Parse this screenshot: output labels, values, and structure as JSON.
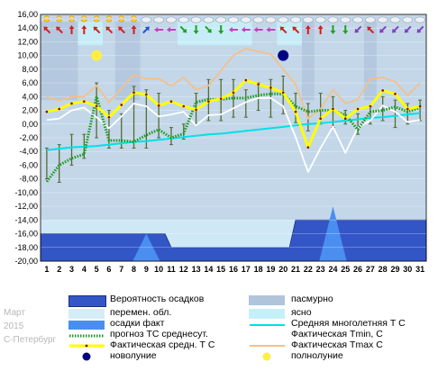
{
  "meta": {
    "month": "Март",
    "year": "2015",
    "city": "С-Петербург"
  },
  "colors": {
    "plot_bg": "#c3d7e9",
    "overcast_band": "#b0c4dc",
    "clear_band": "#c6f0f8",
    "precip_prob": "#3356c6",
    "precip_fact": "#4a8ef0",
    "normal_line": "#00e0e8",
    "fact_avg": "#ffff00",
    "fact_avg_outline": "#c8a800",
    "tmin": "#ffffff",
    "tmax": "#f4c08a",
    "forecast": "#1a9a1a",
    "range_bars": "#556b2f"
  },
  "chart_data": {
    "type": "line",
    "title": "",
    "xlabel": "",
    "ylabel": "",
    "x": [
      1,
      2,
      3,
      4,
      5,
      6,
      7,
      8,
      9,
      10,
      11,
      12,
      13,
      14,
      15,
      16,
      17,
      18,
      19,
      20,
      21,
      22,
      23,
      24,
      25,
      26,
      27,
      28,
      29,
      30,
      31
    ],
    "ylim": [
      -20,
      16
    ],
    "yticks": [
      "16,00",
      "14,00",
      "12,00",
      "10,00",
      "8,00",
      "6,00",
      "4,00",
      "2,00",
      "0,00",
      "-2,00",
      "-4,00",
      "-6,00",
      "-8,00",
      "-10,00",
      "-12,00",
      "-14,00",
      "-16,00",
      "-18,00",
      "-20,00"
    ],
    "xticks": [
      "1",
      "2",
      "3",
      "4",
      "5",
      "6",
      "7",
      "8",
      "9",
      "10",
      "11",
      "12",
      "13",
      "14",
      "15",
      "16",
      "17",
      "18",
      "19",
      "20",
      "21",
      "22",
      "23",
      "24",
      "25",
      "26",
      "27",
      "28",
      "29",
      "30",
      "31"
    ],
    "series": [
      {
        "name": "Фактическая средн. T C",
        "values": [
          1.8,
          2.2,
          3.0,
          3.3,
          2.6,
          1.0,
          2.8,
          4.6,
          4.3,
          2.7,
          3.3,
          2.6,
          2.1,
          3.3,
          3.7,
          4.6,
          6.4,
          5.8,
          5.3,
          4.6,
          1.8,
          -3.4,
          0.8,
          2.2,
          0.8,
          2.2,
          2.6,
          4.9,
          4.4,
          2.2,
          2.6
        ]
      },
      {
        "name": "Фактическая Tmin, C",
        "values": [
          0.6,
          0.8,
          2.0,
          2.4,
          1.0,
          -0.6,
          1.1,
          3.0,
          2.6,
          1.1,
          1.4,
          1.8,
          -0.2,
          1.3,
          1.4,
          2.3,
          3.2,
          3.8,
          3.8,
          2.6,
          -1.9,
          -7.0,
          -3.5,
          -0.4,
          -4.2,
          -0.5,
          0.5,
          2.7,
          1.8,
          0.3,
          0.6
        ]
      },
      {
        "name": "Фактическая Tmax C",
        "values": [
          4.0,
          3.4,
          4.0,
          4.0,
          5.6,
          3.2,
          5.2,
          7.2,
          6.6,
          6.6,
          5.6,
          6.8,
          5.0,
          5.6,
          7.8,
          10.0,
          11.0,
          10.6,
          10.2,
          8.0,
          5.8,
          0.8,
          2.2,
          5.0,
          3.0,
          3.6,
          6.6,
          6.8,
          6.2,
          4.2,
          6.0
        ]
      },
      {
        "name": "Средняя многолетняя T С",
        "values": [
          -3.8,
          -3.6,
          -3.4,
          -3.3,
          -3.2,
          -3.0,
          -2.8,
          -2.6,
          -2.5,
          -2.3,
          -2.1,
          -1.9,
          -1.7,
          -1.5,
          -1.4,
          -1.2,
          -1.0,
          -0.8,
          -0.6,
          -0.4,
          -0.2,
          0.0,
          0.1,
          0.3,
          0.5,
          0.7,
          0.9,
          1.0,
          1.2,
          1.4,
          1.6
        ]
      },
      {
        "name": "прогноз ТС среднесут.",
        "values": [
          -8.4,
          -6.0,
          -5.0,
          -4.4,
          4.0,
          -2.4,
          -2.4,
          -2.6,
          -1.6,
          -0.8,
          -2.0,
          -1.4,
          3.2,
          3.6,
          3.6,
          3.8,
          3.8,
          4.2,
          4.4,
          4.4,
          2.6,
          1.8,
          2.0,
          2.0,
          1.3,
          -0.8,
          1.8,
          2.0,
          2.5,
          1.8,
          2.4
        ]
      }
    ],
    "daily_range": {
      "low": [
        -8.0,
        -8.5,
        -6.0,
        -5.0,
        -2.0,
        -3.5,
        -3.5,
        -3.5,
        -3.5,
        -2.0,
        -3.0,
        -2.2,
        0.0,
        0.5,
        0.5,
        1.0,
        1.0,
        2.0,
        1.0,
        1.5,
        0.2,
        -1.0,
        0.0,
        -0.5,
        0.0,
        -1.5,
        0.0,
        0.5,
        -0.5,
        0.0,
        0.5
      ],
      "high": [
        -3.5,
        -3.0,
        -1.5,
        -1.5,
        6.0,
        2.0,
        1.5,
        5.5,
        5.0,
        4.5,
        -0.5,
        0.0,
        4.5,
        6.5,
        6.5,
        6.5,
        5.0,
        6.0,
        6.5,
        7.0,
        4.5,
        3.0,
        4.5,
        4.0,
        2.0,
        1.5,
        2.5,
        4.0,
        3.5,
        3.0,
        3.5
      ]
    },
    "cloud_bands": {
      "overcast": [
        [
          1,
          3
        ],
        [
          7,
          8
        ],
        [
          22,
          22
        ],
        [
          27,
          27
        ]
      ],
      "clear": [
        [
          4,
          5
        ],
        [
          12,
          17
        ],
        [
          20,
          21
        ]
      ]
    },
    "precip_probability": [
      -16,
      -16,
      -16,
      -16,
      -16,
      -16,
      -16,
      -16,
      -16,
      -16,
      -18,
      -18,
      -18,
      -18,
      -18,
      -18,
      -18,
      -18,
      -18,
      -18,
      -14,
      -14,
      -14,
      -14,
      -14,
      -14,
      -14,
      -14,
      -14,
      -14,
      -14
    ],
    "precip_fact_peaks": [
      {
        "day": 9,
        "top": -16.0
      },
      {
        "day": 24,
        "top": -12.0
      }
    ],
    "new_moon_day": 20,
    "full_moon_day": 5,
    "weather_icons": [
      "sun",
      "sun",
      "sun",
      "sun",
      "sun",
      "sun",
      "sun",
      "sun",
      "cloud",
      "cloud",
      "cloud",
      "cloud",
      "cloud",
      "cloud",
      "cloud",
      "cloud",
      "cloud",
      "cloud",
      "cloud",
      "cloud",
      "cloud",
      "cloud",
      "cloud",
      "cloud",
      "cloud",
      "cloud",
      "cloud",
      "cloud",
      "cloud",
      "cloud",
      "cloud"
    ],
    "wind_arrows": [
      "nw",
      "nw",
      "n",
      "n",
      "nw",
      "nw",
      "nw",
      "n",
      "ne",
      "w",
      "w",
      "se",
      "s",
      "se",
      "s",
      "w",
      "w",
      "w",
      "w",
      "nw",
      "nw",
      "n",
      "n",
      "s",
      "s",
      "sw",
      "nw",
      "sw",
      "sw",
      "sw",
      "sw"
    ]
  },
  "legend": {
    "precip_prob": "Вероятность осадков",
    "overcast": "пасмурно",
    "partly": "перемен. обл.",
    "clear": "ясно",
    "precip_fact": "осадки факт",
    "normal": "Средняя многолетняя Т С",
    "forecast": "прогноз ТС среднесут.",
    "tmin": "Фактическая Tmin, C",
    "fact_avg": "Фактическая средн. Т С",
    "tmax": "Фактическая Tmax C",
    "new_moon": "новолуние",
    "full_moon": "полнолуние"
  }
}
